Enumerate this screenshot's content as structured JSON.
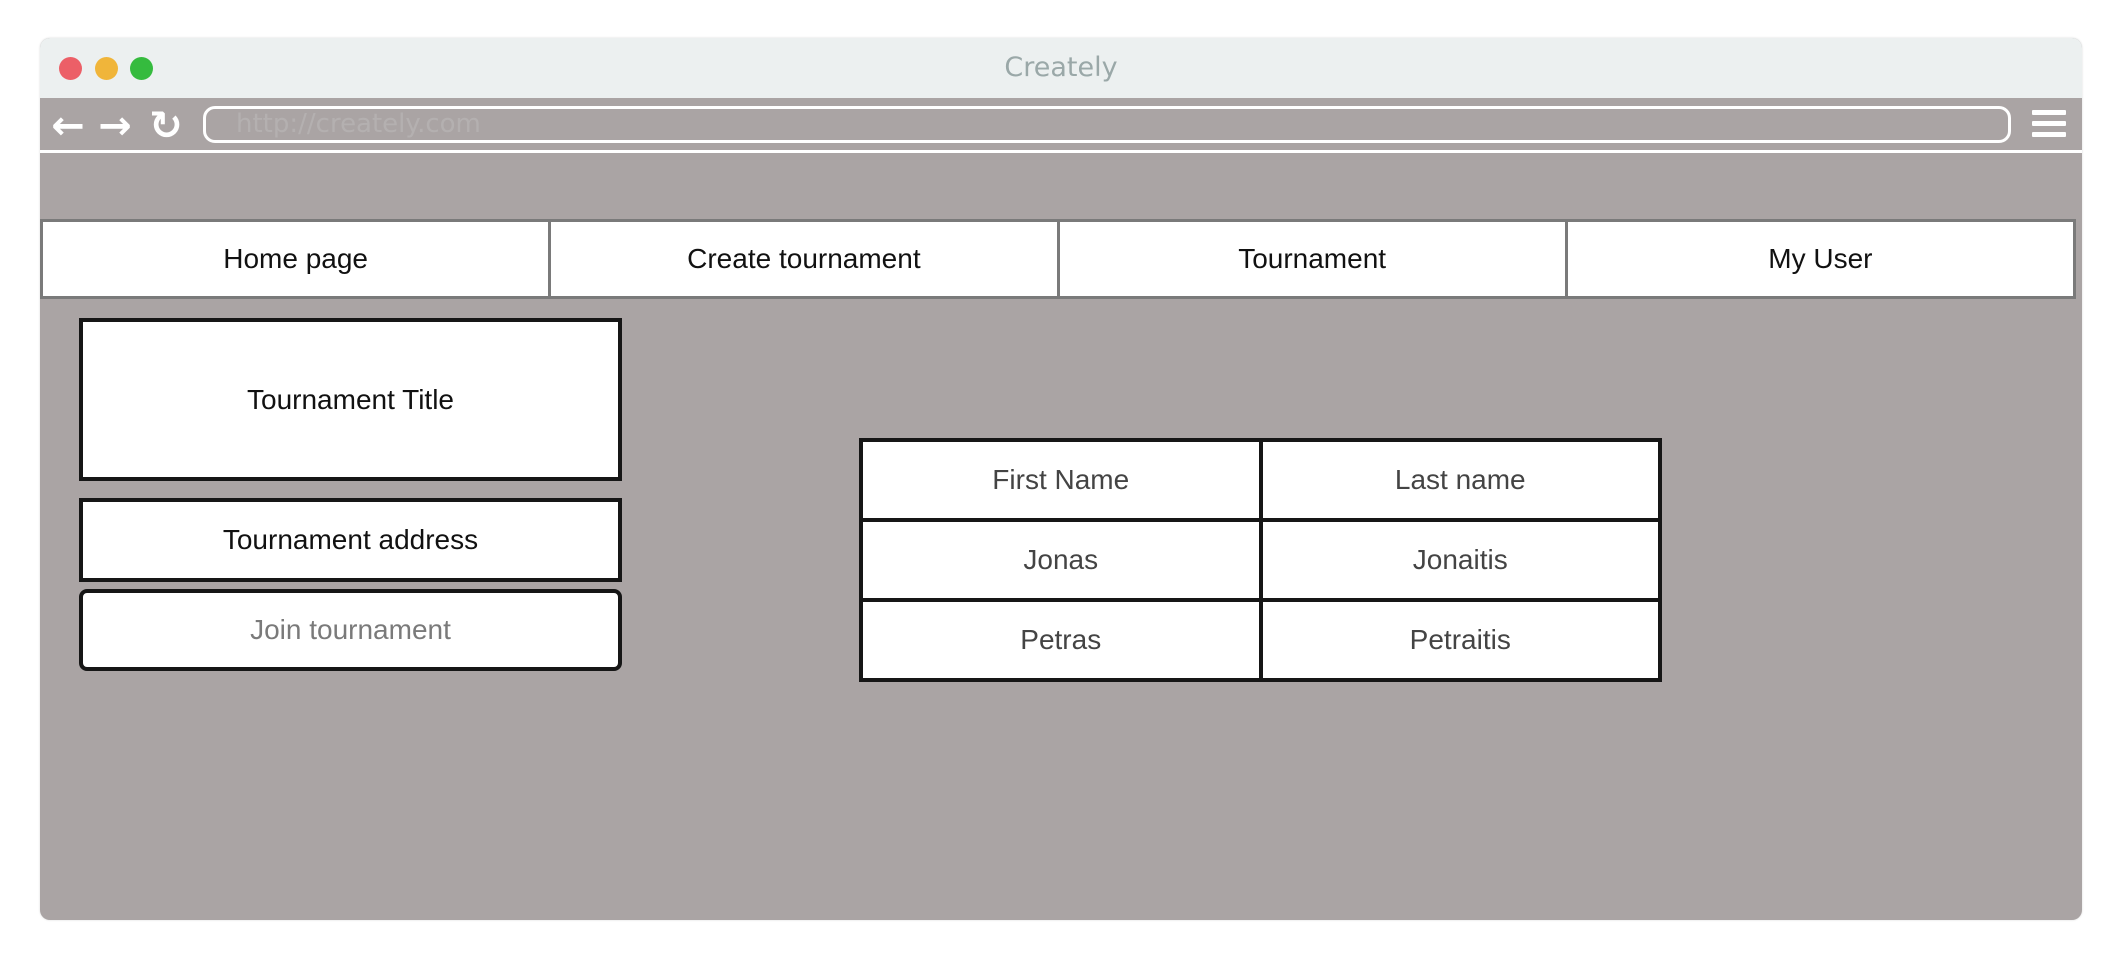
{
  "window": {
    "title": "Creately",
    "address_placeholder": "http://creately.com"
  },
  "icons": {
    "back": "←",
    "forward": "→",
    "reload": "↻"
  },
  "nav": {
    "tabs": [
      {
        "label": "Home page"
      },
      {
        "label": "Create tournament"
      },
      {
        "label": "Tournament"
      },
      {
        "label": "My User"
      }
    ]
  },
  "tournament": {
    "title": "Tournament Title",
    "address": "Tournament address",
    "join_label": "Join tournament"
  },
  "participants": {
    "headers": [
      "First Name",
      "Last name"
    ],
    "rows": [
      [
        "Jonas",
        "Jonaitis"
      ],
      [
        "Petras",
        "Petraitis"
      ]
    ]
  },
  "colors": {
    "background": "#aaa4a4",
    "titlebar": "#ecf0f0",
    "close": "#ec5f67",
    "minimize": "#f0b53a",
    "maximize": "#35bb3e"
  }
}
